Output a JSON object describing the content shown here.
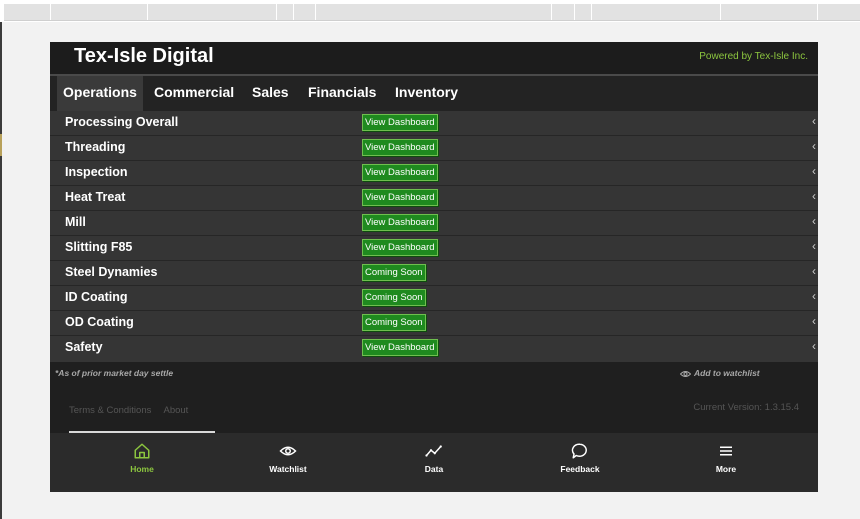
{
  "header": {
    "brand": "Tex-Isle Digital",
    "powered_by": "Powered by Tex-Isle Inc."
  },
  "tabs": [
    {
      "label": "Operations",
      "active": true
    },
    {
      "label": "Commercial",
      "active": false
    },
    {
      "label": "Sales",
      "active": false
    },
    {
      "label": "Financials",
      "active": false
    },
    {
      "label": "Inventory",
      "active": false
    }
  ],
  "rows": [
    {
      "label": "Processing Overall",
      "button": "View Dashboard"
    },
    {
      "label": "Threading",
      "button": "View Dashboard"
    },
    {
      "label": "Inspection",
      "button": "View Dashboard"
    },
    {
      "label": "Heat Treat",
      "button": "View Dashboard"
    },
    {
      "label": "Mill",
      "button": "View Dashboard"
    },
    {
      "label": "Slitting F85",
      "button": "View Dashboard"
    },
    {
      "label": "Steel Dynamies",
      "button": "Coming Soon"
    },
    {
      "label": "ID Coating",
      "button": "Coming Soon"
    },
    {
      "label": "OD Coating",
      "button": "Coming Soon"
    },
    {
      "label": "Safety",
      "button": "View Dashboard"
    }
  ],
  "footer": {
    "note": "*As of prior market day settle",
    "watchlist": "Add to watchlist",
    "terms": "Terms & Conditions",
    "about": "About",
    "version": "Current Version: 1.3.15.4"
  },
  "nav": [
    {
      "label": "Home",
      "icon": "home-icon",
      "active": true
    },
    {
      "label": "Watchlist",
      "icon": "eye-icon",
      "active": false
    },
    {
      "label": "Data",
      "icon": "chart-line-icon",
      "active": false
    },
    {
      "label": "Feedback",
      "icon": "chat-bubble-icon",
      "active": false
    },
    {
      "label": "More",
      "icon": "menu-icon",
      "active": false
    }
  ],
  "colors": {
    "accent": "#8cc63f",
    "button_green": "#1f8a1f",
    "app_bg": "#1f1f1f"
  }
}
